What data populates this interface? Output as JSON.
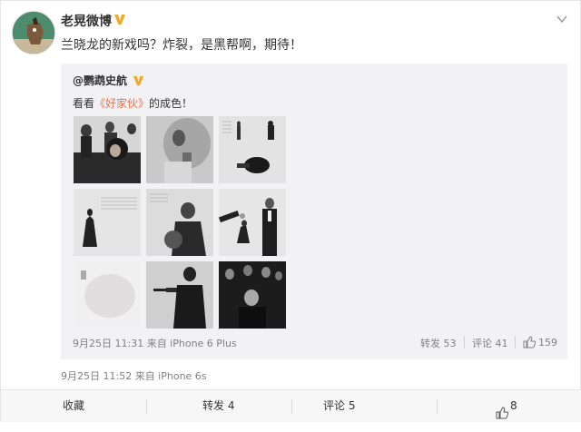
{
  "post": {
    "username": "老晃微博",
    "text": "兰晓龙的新戏吗？炸裂，是黑帮啊，期待！",
    "timestamp": "9月25日 11:52 来自 iPhone 6s"
  },
  "repost": {
    "username": "@鹦鹉史航",
    "text_before": "看看",
    "text_highlight": "《好家伙》",
    "text_after": "的成色！",
    "timestamp": "9月25日 11:31 来自 iPhone 6 Plus",
    "repost_label": "转发 53",
    "comment_label": "评论 41",
    "like_count": "159"
  },
  "bottom_bar": {
    "favorite_label": "收藏",
    "repost_label": "转发 4",
    "comment_label": "评论 5",
    "like_count": "8"
  },
  "colors": {
    "highlight": "#eb7350",
    "verified_badge": "#f5a623"
  }
}
